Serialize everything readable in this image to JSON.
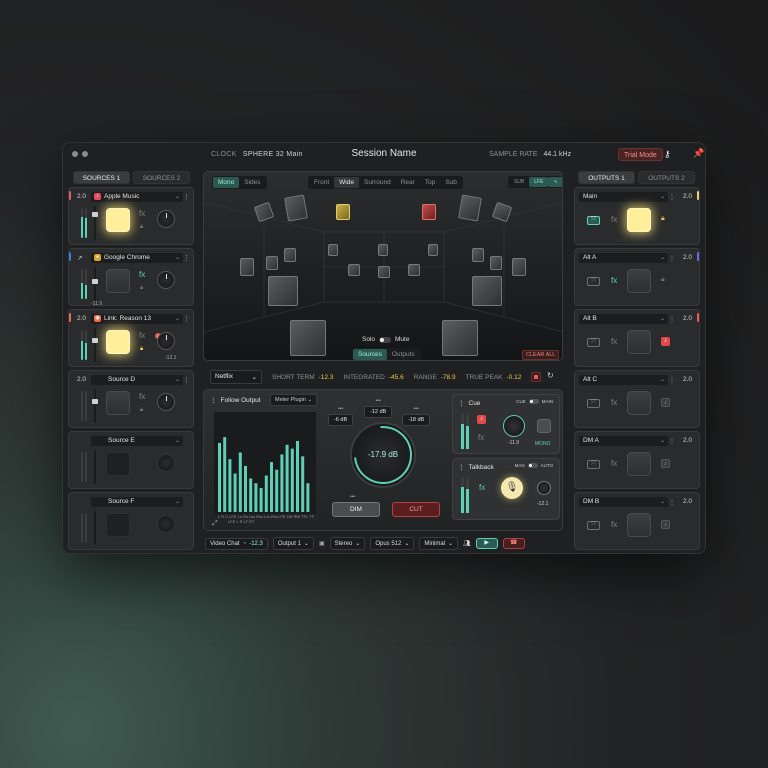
{
  "header": {
    "clock_label": "CLOCK",
    "clock_value": "SPHERE 32 Main",
    "session_name": "Session Name",
    "sample_rate_label": "SAMPLE RATE",
    "sample_rate_value": "44.1 kHz",
    "trial_mode": "Trial Mode"
  },
  "sources": {
    "tabs": [
      "SOURCES 1",
      "SOURCES 2"
    ],
    "strips": [
      {
        "channel": "2.0",
        "name": "Apple Music",
        "color": "#e85a6a",
        "level_db": ""
      },
      {
        "channel": "",
        "name": "Google Chrome",
        "color": "#3b7bd6",
        "level_db": "-11.9"
      },
      {
        "channel": "2.0",
        "name": "Link: Reason 13",
        "color": "#e8684a",
        "level_db": "-12.1",
        "badge": "1"
      },
      {
        "channel": "2.0",
        "name": "Source D",
        "color": "",
        "level_db": ""
      },
      {
        "channel": "",
        "name": "Source E",
        "color": "",
        "level_db": ""
      },
      {
        "channel": "",
        "name": "Source F",
        "color": "",
        "level_db": ""
      }
    ],
    "fx_label": "fx"
  },
  "outputs": {
    "tabs": [
      "OUTPUTS 1",
      "OUTPUTS 2"
    ],
    "strips": [
      {
        "name": "Main",
        "channel": "2.0",
        "color": "#e8d46a"
      },
      {
        "name": "Alt A",
        "channel": "2.0",
        "color": "#6a6ae8"
      },
      {
        "name": "Alt B",
        "channel": "2.0",
        "color": "#e85a5a"
      },
      {
        "name": "Alt C",
        "channel": "2.0",
        "color": ""
      },
      {
        "name": "DM A",
        "channel": "2.0",
        "color": ""
      },
      {
        "name": "DM B",
        "channel": "2.0",
        "color": ""
      }
    ]
  },
  "spatial": {
    "mode_tabs": [
      "Mono",
      "Sides"
    ],
    "view_tabs": [
      "Front",
      "Wide",
      "Surround",
      "Rear",
      "Top",
      "Sub"
    ],
    "selected_view": "Wide",
    "right_tabs": [
      "SUB",
      "LFE"
    ],
    "solo_label": "Solo",
    "mute_label": "Mute",
    "bottom_tabs": [
      "Sources",
      "Outputs"
    ],
    "clear_all": "CLEAR ALL"
  },
  "loudness": {
    "preset": "Netflix",
    "short_term_label": "SHORT TERM",
    "short_term_value": "-12.3",
    "integrated_label": "INTEGRATED",
    "integrated_value": "-45.6",
    "range_label": "RANGE",
    "range_value": "-78.9",
    "true_peak_label": "TRUE PEAK",
    "true_peak_value": "-0.12"
  },
  "monitor": {
    "follow_output": "Follow Output",
    "meter_plugin": "Meter Plugin",
    "meter_bottom_labels": "L R C LFE Ls Rs Lss Rss Lrs Rrs LFE LW RW TFL TFR TRL TRR LUFS",
    "meter_bottom_sub": "LFE   L   R   LT   RT",
    "trims": [
      "-12 dB",
      "-6 dB",
      "-18 dB"
    ],
    "master_level": "-17.9 dB",
    "dim_label": "DIM",
    "cut_label": "CUT"
  },
  "cue": {
    "title": "Cue",
    "mode_a": "CUE",
    "mode_b": "MAIN",
    "fx_label": "fx",
    "mono_label": "MONO",
    "level": "-11.9"
  },
  "talkback": {
    "title": "Talkback",
    "mode_a": "MAN",
    "mode_b": "AUTO",
    "fx_label": "fx",
    "level": "-12.1"
  },
  "bottombar": {
    "app": "Video Chat",
    "level": "-12.3",
    "output": "Output 1",
    "format": "Stereo",
    "codec": "Opus 512",
    "latency": "Minimal"
  }
}
